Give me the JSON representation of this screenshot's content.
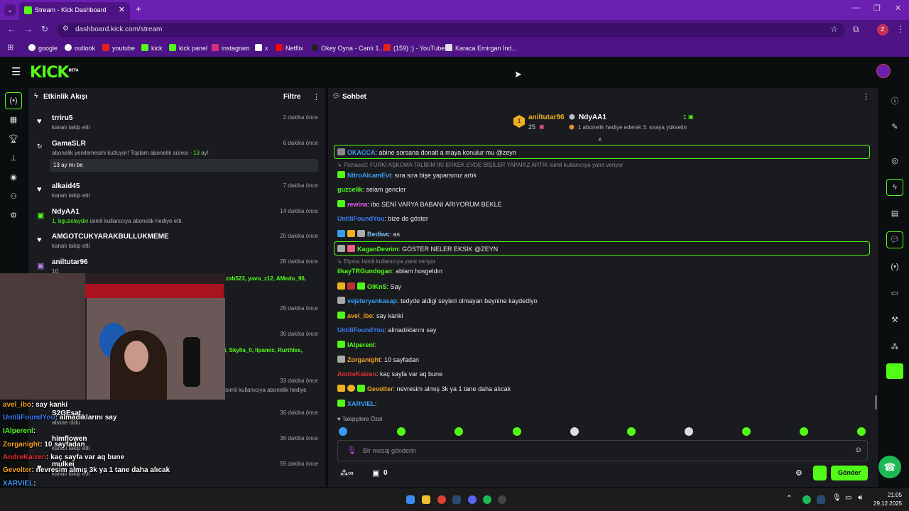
{
  "browser": {
    "tab_title": "Stream - Kick Dashboard",
    "url": "dashboard.kick.com/stream",
    "profile_initial": "Z",
    "bookmarks": [
      "google",
      "outlook",
      "youtube",
      "kick",
      "kick panel",
      "instagram",
      "x",
      "Netflix",
      "Okey Oyna - Canlı 1...",
      "(159) :) - YouTube",
      "Karaca Emirgan İnd..."
    ]
  },
  "app": {
    "logo": "KICK",
    "logo_sup": "BETA"
  },
  "activity": {
    "title": "Etkinlik Akışı",
    "filter_label": "Filtre",
    "items": [
      {
        "name": "trriru5",
        "sub": "kanalı takip etti",
        "time": "2 dakika önce"
      },
      {
        "name": "GamaSLR",
        "sub_pre": "abonelik yenilemesini kutluyor! Toplam abonelik süresi - ",
        "sub_num": "13",
        "sub_post": " ay!",
        "message": "13 ay mı be",
        "time": "6 dakika önce"
      },
      {
        "name": "alkaid45",
        "sub": "kanalı takip etti",
        "time": "7 dakika önce"
      },
      {
        "name": "NdyAA1",
        "sub_green": "1, bguzelaydin",
        "sub": " isimli kullanıcıya abonelik hediye etti.",
        "time": "14 dakika önce"
      },
      {
        "name": "AMGOTCUKYARAKBULLUKMEME",
        "sub": "kanalı takip etti",
        "time": "20 dakika önce"
      },
      {
        "name": "aniltutar96",
        "sub_green": "10,",
        "time": "28 dakika önce"
      },
      {
        "extra": "zab523, yavu_z12, AMedo_96,",
        "time": "29 dakika önce"
      },
      {
        "extra": "l, Skylla_0, lipamic, Rurthles,",
        "time": "30 dakika önce"
      },
      {
        "extra": "isimli kullanıcıya abonelik hediye",
        "time": "33 dakika önce"
      },
      {
        "name": "S2GEsat",
        "sub": "abone oldu",
        "time": "36 dakika önce"
      },
      {
        "name": "himflowen",
        "sub": "kanalı takip etti",
        "time": "36 dakika önce"
      },
      {
        "name": "mulkei",
        "sub": "kanalı takip etti",
        "time": "59 dakika önce"
      }
    ]
  },
  "chat": {
    "title": "Sohbet",
    "leaders": {
      "first_name": "aniltutar96",
      "first_rank": "1",
      "first_count": "25",
      "second_name": "NdyAA1",
      "second_rank": "1",
      "second_note": "1 abonelik hediye ederek 3. sıraya yükselin"
    },
    "messages": [
      {
        "kind": "msg",
        "user": "OKACCA",
        "color": "#3a9cf0",
        "text": ": abine sorsana donalt a maya konulur mu @zeyn",
        "highlight": true
      },
      {
        "kind": "reply",
        "text": "Pichass0: FURKİ AŞKOMA TALİBİM İKİ ERKEK EVDE BİŞİLER YAPARIZ ARTIK isimli kullanıcıya yanıt veriyor"
      },
      {
        "kind": "msg",
        "user": "NitroAlcamEvi",
        "color": "#3a9cf0",
        "text": ": sıra sıra bişe yaparsınız artık"
      },
      {
        "kind": "msg",
        "user": "guzcelik",
        "color": "#53fc18",
        "text": ": selam gencler"
      },
      {
        "kind": "msg",
        "user": "rewina",
        "color": "#e05cf0",
        "text": ": ibo SENİ VARYA BABANI ARIYORUM BEKLE"
      },
      {
        "kind": "msg",
        "user": "UntiliFoundYou",
        "color": "#3a7cf0",
        "text": ": bize de göster"
      },
      {
        "kind": "msg",
        "user": "Bediwc",
        "color": "#7cc0f0",
        "text": ": as"
      },
      {
        "kind": "msg",
        "user": "KaganDevrim",
        "color": "#53fc18",
        "text": ": GÖSTER NELER EKSİK @ZEYN",
        "highlight": true
      },
      {
        "kind": "reply",
        "text": "Elysia:    isimli kullanıcıya yanıt veriyor"
      },
      {
        "kind": "msg",
        "user": "ilkayTRGundogan",
        "color": "#53fc18",
        "text": ": ablam hosgeldın"
      },
      {
        "kind": "msg",
        "user": "OlKnS",
        "color": "#53fc18",
        "text": ": Say"
      },
      {
        "kind": "msg",
        "user": "vejeteryankasap",
        "color": "#3a9cf0",
        "text": ": tedyde aldigi seyleri olmayan beynine kaydediyo"
      },
      {
        "kind": "msg",
        "user": "avel_ibo",
        "color": "#f0a020",
        "text": ": say kanki"
      },
      {
        "kind": "msg",
        "user": "UntiliFoundYou",
        "color": "#3a7cf0",
        "text": ": almadıklarını say"
      },
      {
        "kind": "msg",
        "user": "IAlperenl",
        "color": "#53fc18",
        "text": ":"
      },
      {
        "kind": "msg",
        "user": "Zorganight",
        "color": "#f0a020",
        "text": ": 10 sayfadan"
      },
      {
        "kind": "msg",
        "user": "AndreKaizen",
        "color": "#e03030",
        "text": ": kaç sayfa var aq bune"
      },
      {
        "kind": "msg",
        "user": "Gevolter",
        "color": "#f0a020",
        "text": ": nevresim almış 3k ya 1 tane daha alıcak"
      },
      {
        "kind": "msg",
        "user": "XARVIEL",
        "color": "#3a9cf0",
        "text": ":"
      }
    ],
    "emote_tab": "Takipçilere Özel",
    "input_placeholder": "Bir mesaj gönderin",
    "gift_count": "0",
    "send_label": "Gönder"
  },
  "overlay": [
    {
      "user": "avel_ibo",
      "color": "#f0a020",
      "text": ": say kanki"
    },
    {
      "user": "UntiliFoundYou",
      "color": "#3a7cf0",
      "text": ": almadıklarını say"
    },
    {
      "user": "IAlperenl",
      "color": "#53fc18",
      "text": ":"
    },
    {
      "user": "Zorganight",
      "color": "#f0a020",
      "text": ": 10 sayfadan"
    },
    {
      "user": "AndreKaizen",
      "color": "#e03030",
      "text": ": kaç sayfa var aq bune"
    },
    {
      "user": "Gevolter",
      "color": "#f0a020",
      "text": ": nevresim almış 3k ya 1 tane daha alıcak"
    },
    {
      "user": "XARVIEL",
      "color": "#3a9cf0",
      "text": ":"
    }
  ],
  "taskbar": {
    "time": "21:05",
    "date": "29.12.2025"
  },
  "colors": {
    "brand": "#53fc18",
    "browser_accent": "#6a1fb0",
    "panel_bg": "#191b1f"
  }
}
